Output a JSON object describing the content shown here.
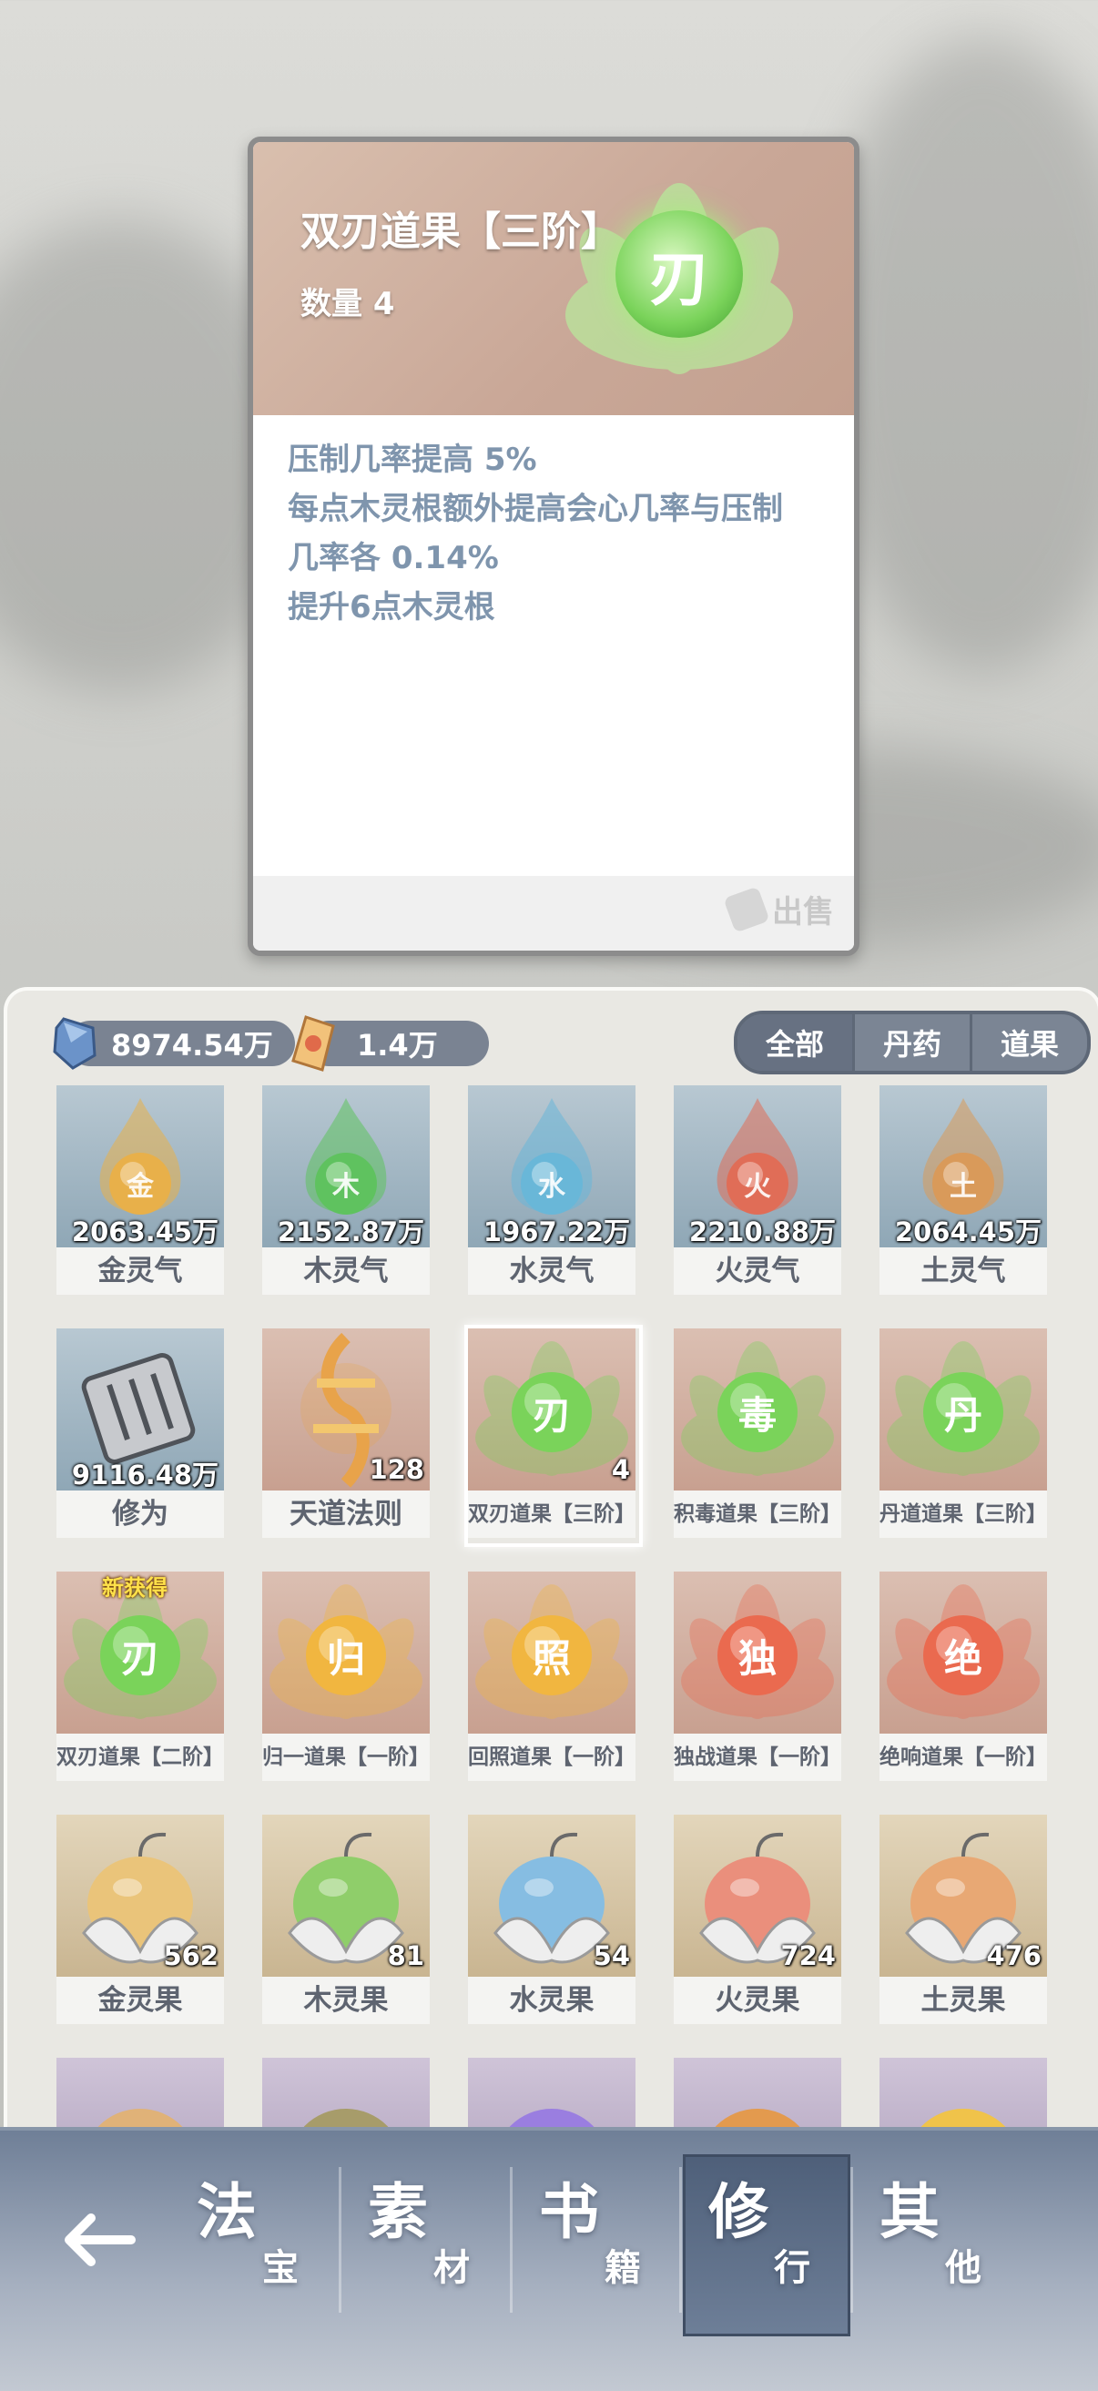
{
  "detail": {
    "title": "双刃道果【三阶】",
    "quantity": "数量 4",
    "orb_glyph": "刃",
    "description": [
      "压制几率提高 5%",
      "每点木灵根额外提高会心几率与压制",
      "几率各 0.14%",
      "提升6点木灵根"
    ],
    "sell_label": "出售"
  },
  "currencies": [
    {
      "name": "spirit-stone",
      "value": "8974.54万",
      "color": "#6b93c9"
    },
    {
      "name": "talisman",
      "value": "1.4万",
      "color": "#e3a85a"
    }
  ],
  "filters": [
    "全部",
    "丹药",
    "道果"
  ],
  "active_filter": "全部",
  "items": [
    {
      "name": "金灵气",
      "count": "2063.45万",
      "glyph": "金",
      "type": "flame",
      "color": "#e8b04a",
      "bg": "blue"
    },
    {
      "name": "木灵气",
      "count": "2152.87万",
      "glyph": "木",
      "type": "flame",
      "color": "#5fc25f",
      "bg": "blue"
    },
    {
      "name": "水灵气",
      "count": "1967.22万",
      "glyph": "水",
      "type": "flame",
      "color": "#69b7d8",
      "bg": "blue"
    },
    {
      "name": "火灵气",
      "count": "2210.88万",
      "glyph": "火",
      "type": "flame",
      "color": "#e06d57",
      "bg": "blue"
    },
    {
      "name": "土灵气",
      "count": "2064.45万",
      "glyph": "土",
      "type": "flame",
      "color": "#d99a5a",
      "bg": "blue"
    },
    {
      "name": "修为",
      "count": "9116.48万",
      "glyph": "",
      "type": "scroll",
      "color": "#8a8f96",
      "bg": "blue"
    },
    {
      "name": "天道法则",
      "count": "128",
      "glyph": "",
      "type": "rune",
      "color": "#e8a34a",
      "bg": "pink"
    },
    {
      "name": "双刃道果【三阶】",
      "count": "4",
      "glyph": "刃",
      "type": "orb",
      "color": "#7ad35a",
      "bg": "pink",
      "selected": true
    },
    {
      "name": "积毒道果【三阶】",
      "count": "",
      "glyph": "毒",
      "type": "orb",
      "color": "#7ad35a",
      "bg": "pink"
    },
    {
      "name": "丹道道果【三阶】",
      "count": "",
      "glyph": "丹",
      "type": "orb",
      "color": "#7ad35a",
      "bg": "pink"
    },
    {
      "name": "双刃道果【二阶】",
      "count": "",
      "glyph": "刃",
      "type": "orb",
      "color": "#7ad35a",
      "bg": "pink",
      "new": "新获得"
    },
    {
      "name": "归一道果【一阶】",
      "count": "",
      "glyph": "归",
      "type": "orb",
      "color": "#f1b640",
      "bg": "pink"
    },
    {
      "name": "回照道果【一阶】",
      "count": "",
      "glyph": "照",
      "type": "orb",
      "color": "#f1b640",
      "bg": "pink"
    },
    {
      "name": "独战道果【一阶】",
      "count": "",
      "glyph": "独",
      "type": "orb",
      "color": "#ea6a4f",
      "bg": "pink"
    },
    {
      "name": "绝响道果【一阶】",
      "count": "",
      "glyph": "绝",
      "type": "orb",
      "color": "#ea6a4f",
      "bg": "pink"
    },
    {
      "name": "金灵果",
      "count": "562",
      "glyph": "",
      "type": "fruit",
      "color": "#eac47a",
      "bg": "tan"
    },
    {
      "name": "木灵果",
      "count": "81",
      "glyph": "",
      "type": "fruit",
      "color": "#8fce6a",
      "bg": "tan"
    },
    {
      "name": "水灵果",
      "count": "54",
      "glyph": "",
      "type": "fruit",
      "color": "#86bde2",
      "bg": "tan"
    },
    {
      "name": "火灵果",
      "count": "724",
      "glyph": "",
      "type": "fruit",
      "color": "#ea8f7c",
      "bg": "tan"
    },
    {
      "name": "土灵果",
      "count": "476",
      "glyph": "",
      "type": "fruit",
      "color": "#e8a874",
      "bg": "tan"
    },
    {
      "name": "",
      "count": "",
      "glyph": "",
      "type": "ball",
      "color": "#e0b278",
      "bg": "purple"
    },
    {
      "name": "",
      "count": "",
      "glyph": "",
      "type": "ball",
      "color": "#a79c6a",
      "bg": "purple"
    },
    {
      "name": "",
      "count": "",
      "glyph": "",
      "type": "ball",
      "color": "#9a7ee0",
      "bg": "purple"
    },
    {
      "name": "",
      "count": "",
      "glyph": "",
      "type": "ball",
      "color": "#e39a4e",
      "bg": "purple"
    },
    {
      "name": "",
      "count": "",
      "glyph": "",
      "type": "ball",
      "color": "#f0c34a",
      "bg": "purple"
    }
  ],
  "nav": {
    "back_icon": "arrow-left-icon",
    "tabs": [
      {
        "big": "法",
        "small": "宝"
      },
      {
        "big": "素",
        "small": "材"
      },
      {
        "big": "书",
        "small": "籍"
      },
      {
        "big": "修",
        "small": "行"
      },
      {
        "big": "其",
        "small": "他"
      }
    ],
    "active_tab": "修行"
  }
}
